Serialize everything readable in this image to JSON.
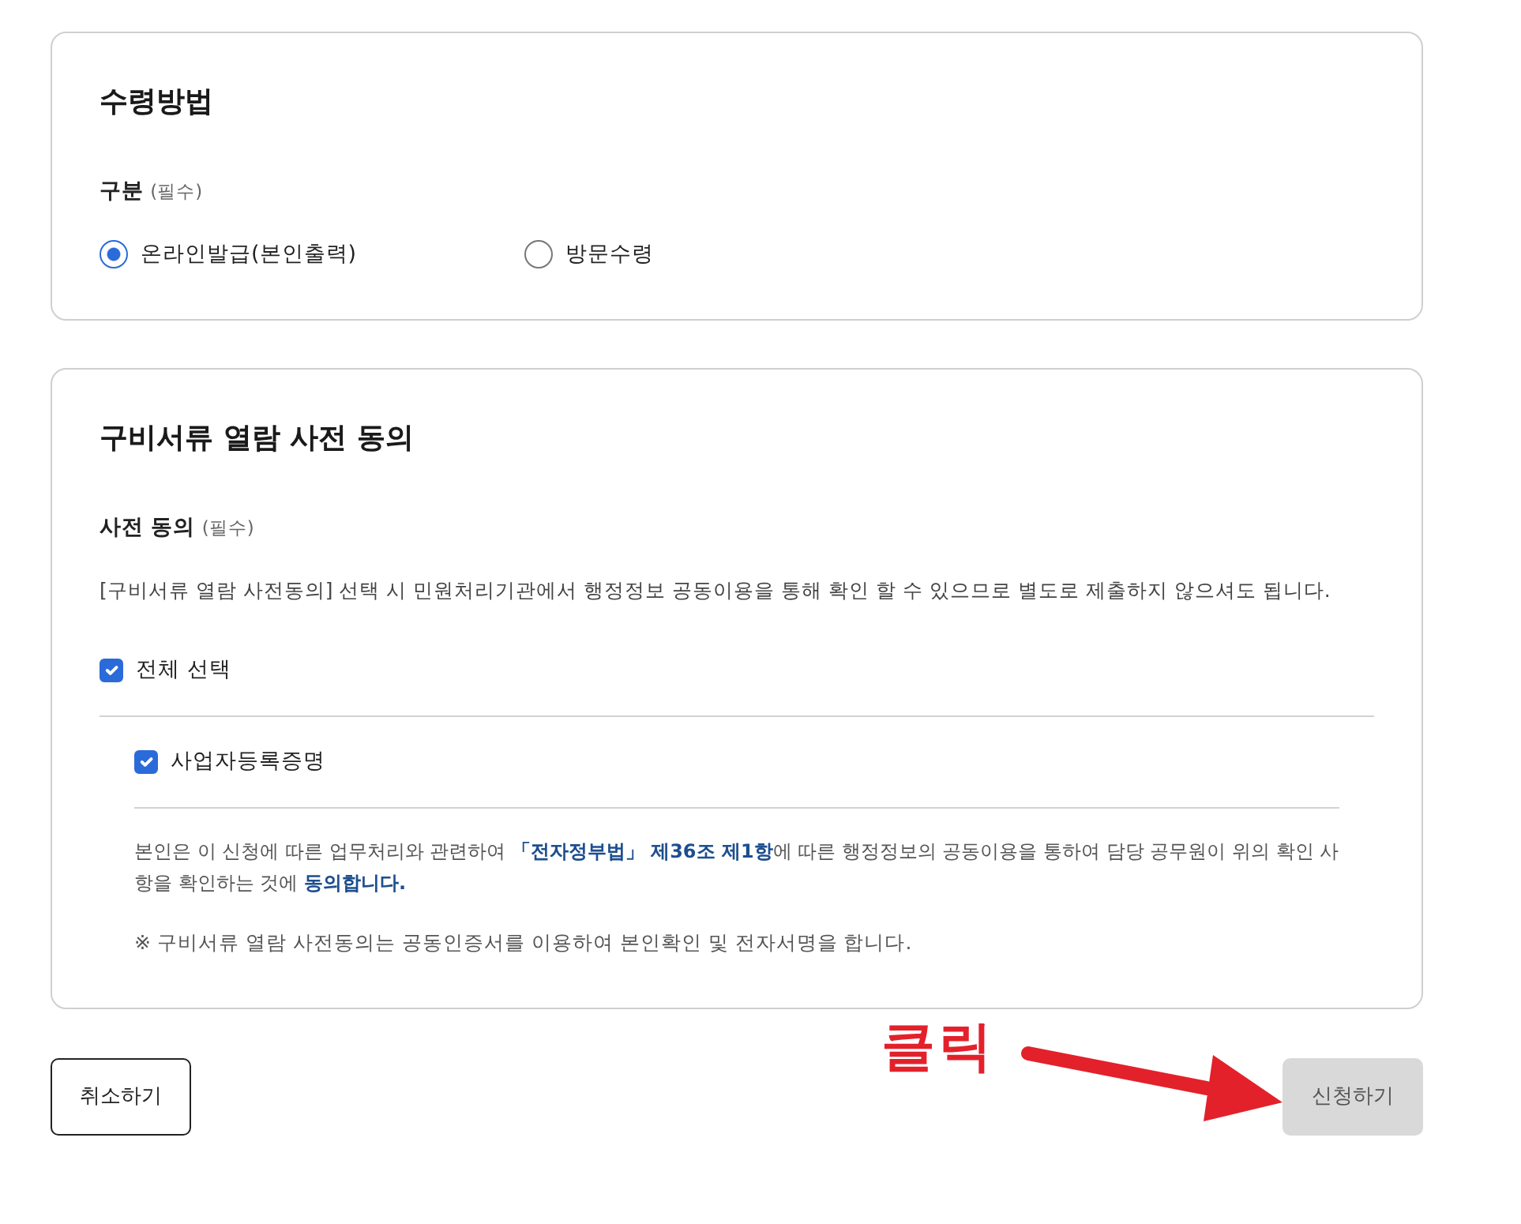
{
  "receipt_method": {
    "title": "수령방법",
    "field_label": "구분",
    "required_mark": "(필수)",
    "options": [
      {
        "label": "온라인발급(본인출력)",
        "selected": true
      },
      {
        "label": "방문수령",
        "selected": false
      }
    ]
  },
  "prior_consent": {
    "title": "구비서류 열람 사전 동의",
    "field_label": "사전 동의",
    "required_mark": "(필수)",
    "description": "[구비서류 열람 사전동의] 선택 시 민원처리기관에서 행정정보 공동이용을 통해 확인 할 수 있으므로 별도로 제출하지 않으셔도 됩니다.",
    "select_all": {
      "label": "전체 선택",
      "checked": true
    },
    "documents": [
      {
        "label": "사업자등록증명",
        "checked": true
      }
    ],
    "agreement": "본인은 이 신청에 따른 업무처리와 관련하여 **「전자정부법」 제36조 제1항**에 따른 행정정보의 공동이용을 통하여 담당 공무원이 위의 확인 사항을 확인하는 것에 **동의합니다.**",
    "note": "※ 구비서류 열람 사전동의는 공동인증서를 이용하여 본인확인 및 전자서명을 합니다."
  },
  "buttons": [
    {
      "label": "취소하기",
      "kind": "cancel",
      "disabled": false
    },
    {
      "label": "신청하기",
      "kind": "submit",
      "disabled": true
    }
  ],
  "annotation": {
    "text": "클릭"
  }
}
